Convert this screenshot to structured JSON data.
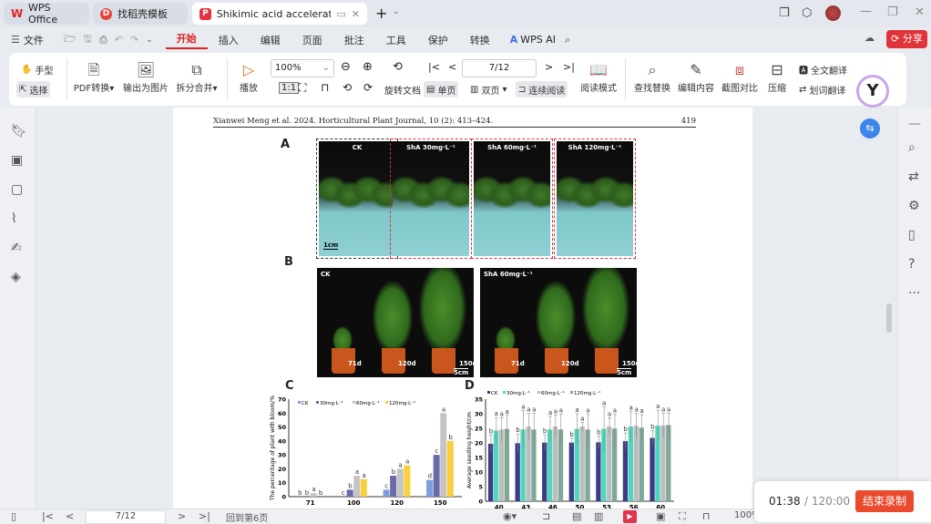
{
  "tabs": [
    {
      "label": "WPS Office",
      "icon": "wps-logo"
    },
    {
      "label": "找稻壳模板",
      "icon": "docer-logo"
    },
    {
      "label": "Shikimic acid accelerates ph",
      "icon": "pdf-icon",
      "active": true
    }
  ],
  "menu": {
    "file": "文件",
    "items": [
      "开始",
      "插入",
      "编辑",
      "页面",
      "批注",
      "工具",
      "保护",
      "转换"
    ],
    "active": "开始",
    "ai": "WPS AI",
    "share": "分享"
  },
  "toolbar": {
    "hand": "手型",
    "select": "选择",
    "pdf_convert": "PDF转换",
    "export_image": "输出为图片",
    "split_merge": "拆分合并",
    "play": "播放",
    "zoom": "100%",
    "page_input": "7/12",
    "rotate": "旋转文档",
    "single": "单页",
    "double": "双页",
    "continuous": "连续阅读",
    "read_mode": "阅读模式",
    "find_replace": "查找替换",
    "edit_content": "编辑内容",
    "screenshot_compare": "截图对比",
    "compress": "压缩",
    "full_translate": "全文翻译",
    "word_translate": "划词翻译"
  },
  "document": {
    "header": "Xianwei Meng et al. 2024. Horticultural Plant Journal, 10 (2): 413–424.",
    "page_number": "419",
    "panel_a": {
      "letter": "A",
      "labels": [
        "CK",
        "ShA 30mg·L⁻¹",
        "ShA 60mg·L⁻¹",
        "ShA 120mg·L⁻¹"
      ],
      "scale": "1cm"
    },
    "panel_b": {
      "letter": "B",
      "left_label": "CK",
      "right_label": "ShA 60mg·L⁻¹",
      "days": [
        "71d",
        "120d",
        "150d"
      ],
      "scale": "5cm"
    }
  },
  "chart_data": [
    {
      "panel": "C",
      "type": "bar",
      "ylabel": "The percentage of plant with bloom/%",
      "categories": [
        "71",
        "100",
        "120",
        "150"
      ],
      "ylim": [
        0,
        70
      ],
      "yticks": [
        0,
        10,
        20,
        30,
        40,
        50,
        60,
        70
      ],
      "legend_position": "top",
      "series": [
        {
          "name": "CK",
          "color": "#7b9fdc",
          "values": [
            0,
            0,
            5,
            12
          ],
          "letters": [
            "b",
            "c",
            "c",
            "d"
          ]
        },
        {
          "name": "30mg·L⁻¹",
          "color": "#6a6aa8",
          "values": [
            0,
            5,
            15,
            30
          ],
          "letters": [
            "b",
            "b",
            "b",
            "c"
          ]
        },
        {
          "name": "60mg·L⁻¹",
          "color": "#c4c4c4",
          "values": [
            2.5,
            15,
            20,
            60
          ],
          "letters": [
            "a",
            "a",
            "a",
            "a"
          ]
        },
        {
          "name": "120mg·L⁻¹",
          "color": "#f9cf3c",
          "values": [
            0,
            12.5,
            22.5,
            40
          ],
          "letters": [
            "b",
            "a",
            "a",
            "b"
          ]
        }
      ]
    },
    {
      "panel": "D",
      "type": "bar",
      "ylabel": "Average seedling height/cm",
      "categories": [
        "40",
        "43",
        "46",
        "50",
        "53",
        "56",
        "60"
      ],
      "ylim": [
        0,
        35
      ],
      "yticks": [
        0,
        5,
        10,
        15,
        20,
        25,
        30,
        35
      ],
      "legend_position": "top",
      "error_bars": true,
      "series": [
        {
          "name": "CK",
          "color": "#3b3b86",
          "values": [
            19.7,
            19.9,
            20.1,
            20.1,
            20.2,
            20.6,
            21.7
          ],
          "errors": [
            3,
            3.2,
            2.7,
            1.5,
            2.2,
            2.8,
            2.5
          ],
          "letters": [
            "b",
            "b",
            "b",
            "b",
            "b",
            "b",
            "b"
          ]
        },
        {
          "name": "30mg·L⁻¹",
          "color": "#4fd6bc",
          "values": [
            24.2,
            24.6,
            24.6,
            24.8,
            24.8,
            25.6,
            25.9
          ],
          "errors": [
            4.5,
            6.5,
            4.5,
            5.2,
            7.5,
            5.2,
            5.3
          ],
          "letters": [
            "a",
            "a",
            "a",
            "a",
            "a",
            "a",
            "a"
          ]
        },
        {
          "name": "60mg·L⁻¹",
          "color": "#bdbdbd",
          "values": [
            24.6,
            25.6,
            25.6,
            25.6,
            25.6,
            25.9,
            25.9
          ],
          "errors": [
            4,
            4.5,
            4,
            1.5,
            3,
            4.3,
            4.2
          ],
          "letters": [
            "a",
            "a",
            "a",
            "a",
            "a",
            "a",
            "a"
          ]
        },
        {
          "name": "120mg·L⁻¹",
          "color": "#7fa897",
          "values": [
            24.8,
            24.6,
            24.6,
            24.6,
            24.9,
            25.2,
            26.1
          ],
          "errors": [
            4.6,
            5.6,
            5.2,
            5.2,
            5,
            4.5,
            4
          ],
          "letters": [
            "a",
            "a",
            "a",
            "a",
            "a",
            "a",
            "a"
          ]
        }
      ]
    }
  ],
  "status": {
    "page_input": "7/12",
    "back_to": "回到第6页",
    "zoom": "100%"
  },
  "recording": {
    "elapsed": "01:38",
    "total": "/ 120:00",
    "stop": "结束录制"
  }
}
